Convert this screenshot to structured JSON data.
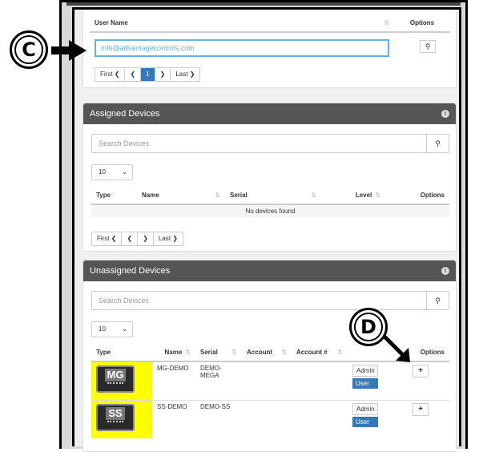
{
  "users_table": {
    "columns": [
      "User Name",
      "Options"
    ],
    "user_input_value": "info@advantagecontrols.com",
    "pager": [
      "First ❮",
      "❮",
      "1",
      "❯",
      "Last ❯"
    ]
  },
  "assigned": {
    "title": "Assigned Devices",
    "search_placeholder": "Search Devices",
    "page_size": "10",
    "columns": [
      "Type",
      "Name",
      "Serial",
      "Level",
      "Options"
    ],
    "empty_text": "No devices found",
    "pager": [
      "First ❮",
      "❮",
      "❯",
      "Last ❯"
    ]
  },
  "unassigned": {
    "title": "Unassigned Devices",
    "search_placeholder": "Search Devices",
    "page_size": "10",
    "columns": [
      "Type",
      "Name",
      "Serial",
      "Account",
      "Account #",
      "Options"
    ],
    "rows": [
      {
        "type": "MG",
        "name": "MG-DEMO",
        "serial": "DEMO-MEGA",
        "account": "",
        "account_num": "",
        "level_admin": "Admin",
        "level_user": "User",
        "action": "+"
      },
      {
        "type": "SS",
        "name": "SS-DEMO",
        "serial": "DEMO-SS",
        "account": "",
        "account_num": "",
        "level_admin": "Admin",
        "level_user": "User",
        "action": "+"
      }
    ]
  },
  "callouts": {
    "c": "C",
    "d": "D"
  },
  "colors": {
    "header": "#555555",
    "highlight": "#ffff00",
    "primary": "#337ab7"
  }
}
